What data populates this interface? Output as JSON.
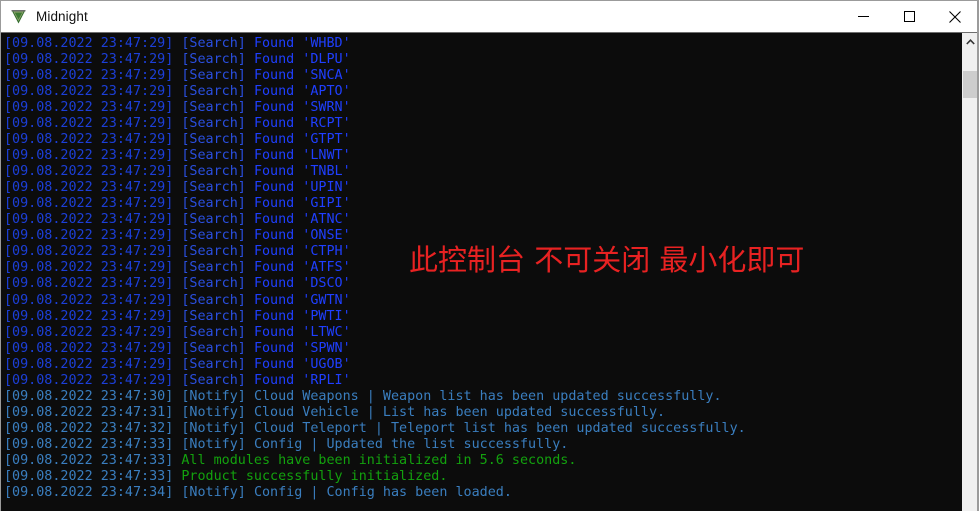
{
  "window": {
    "title": "Midnight",
    "icon": "midnight-v-logo",
    "controls": {
      "minimize": "minimize-icon",
      "maximize": "maximize-icon",
      "close": "close-icon"
    }
  },
  "overlay": {
    "warning_text": "此控制台 不可关闭 最小化即可",
    "warning_color": "#e82222"
  },
  "colors": {
    "console_background": "#0c0c0c",
    "search_blue": "#1f3fff",
    "notify_blue": "#3a7ebf",
    "success_green": "#13a10e",
    "titlebar_background": "#ffffff"
  },
  "scrollbar": {
    "up_arrow": "chevron-up-icon",
    "thumb_position_percent": 6
  },
  "console": {
    "lines": [
      {
        "kind": "search",
        "timestamp": "[09.08.2022 23:47:29]",
        "tag": "[Search]",
        "message": "Found 'WHBD'"
      },
      {
        "kind": "search",
        "timestamp": "[09.08.2022 23:47:29]",
        "tag": "[Search]",
        "message": "Found 'DLPU'"
      },
      {
        "kind": "search",
        "timestamp": "[09.08.2022 23:47:29]",
        "tag": "[Search]",
        "message": "Found 'SNCA'"
      },
      {
        "kind": "search",
        "timestamp": "[09.08.2022 23:47:29]",
        "tag": "[Search]",
        "message": "Found 'APTO'"
      },
      {
        "kind": "search",
        "timestamp": "[09.08.2022 23:47:29]",
        "tag": "[Search]",
        "message": "Found 'SWRN'"
      },
      {
        "kind": "search",
        "timestamp": "[09.08.2022 23:47:29]",
        "tag": "[Search]",
        "message": "Found 'RCPT'"
      },
      {
        "kind": "search",
        "timestamp": "[09.08.2022 23:47:29]",
        "tag": "[Search]",
        "message": "Found 'GTPT'"
      },
      {
        "kind": "search",
        "timestamp": "[09.08.2022 23:47:29]",
        "tag": "[Search]",
        "message": "Found 'LNWT'"
      },
      {
        "kind": "search",
        "timestamp": "[09.08.2022 23:47:29]",
        "tag": "[Search]",
        "message": "Found 'TNBL'"
      },
      {
        "kind": "search",
        "timestamp": "[09.08.2022 23:47:29]",
        "tag": "[Search]",
        "message": "Found 'UPIN'"
      },
      {
        "kind": "search",
        "timestamp": "[09.08.2022 23:47:29]",
        "tag": "[Search]",
        "message": "Found 'GIPI'"
      },
      {
        "kind": "search",
        "timestamp": "[09.08.2022 23:47:29]",
        "tag": "[Search]",
        "message": "Found 'ATNC'"
      },
      {
        "kind": "search",
        "timestamp": "[09.08.2022 23:47:29]",
        "tag": "[Search]",
        "message": "Found 'ONSE'"
      },
      {
        "kind": "search",
        "timestamp": "[09.08.2022 23:47:29]",
        "tag": "[Search]",
        "message": "Found 'CTPH'"
      },
      {
        "kind": "search",
        "timestamp": "[09.08.2022 23:47:29]",
        "tag": "[Search]",
        "message": "Found 'ATFS'"
      },
      {
        "kind": "search",
        "timestamp": "[09.08.2022 23:47:29]",
        "tag": "[Search]",
        "message": "Found 'DSCO'"
      },
      {
        "kind": "search",
        "timestamp": "[09.08.2022 23:47:29]",
        "tag": "[Search]",
        "message": "Found 'GWTN'"
      },
      {
        "kind": "search",
        "timestamp": "[09.08.2022 23:47:29]",
        "tag": "[Search]",
        "message": "Found 'PWTI'"
      },
      {
        "kind": "search",
        "timestamp": "[09.08.2022 23:47:29]",
        "tag": "[Search]",
        "message": "Found 'LTWC'"
      },
      {
        "kind": "search",
        "timestamp": "[09.08.2022 23:47:29]",
        "tag": "[Search]",
        "message": "Found 'SPWN'"
      },
      {
        "kind": "search",
        "timestamp": "[09.08.2022 23:47:29]",
        "tag": "[Search]",
        "message": "Found 'UGOB'"
      },
      {
        "kind": "search",
        "timestamp": "[09.08.2022 23:47:29]",
        "tag": "[Search]",
        "message": "Found 'RPLI'"
      },
      {
        "kind": "notify",
        "timestamp": "[09.08.2022 23:47:30]",
        "tag": "[Notify]",
        "message": "Cloud Weapons | Weapon list has been updated successfully."
      },
      {
        "kind": "notify",
        "timestamp": "[09.08.2022 23:47:31]",
        "tag": "[Notify]",
        "message": "Cloud Vehicle | List has been updated successfully."
      },
      {
        "kind": "notify",
        "timestamp": "[09.08.2022 23:47:32]",
        "tag": "[Notify]",
        "message": "Cloud Teleport | Teleport list has been updated successfully."
      },
      {
        "kind": "notify",
        "timestamp": "[09.08.2022 23:47:33]",
        "tag": "[Notify]",
        "message": "Config | Updated the list successfully."
      },
      {
        "kind": "success",
        "timestamp": "[09.08.2022 23:47:33]",
        "tag": "",
        "message": "All modules have been initialized in 5.6 seconds."
      },
      {
        "kind": "success",
        "timestamp": "[09.08.2022 23:47:33]",
        "tag": "",
        "message": "Product successfully initialized."
      },
      {
        "kind": "notify",
        "timestamp": "[09.08.2022 23:47:34]",
        "tag": "[Notify]",
        "message": "Config | Config has been loaded."
      }
    ]
  }
}
